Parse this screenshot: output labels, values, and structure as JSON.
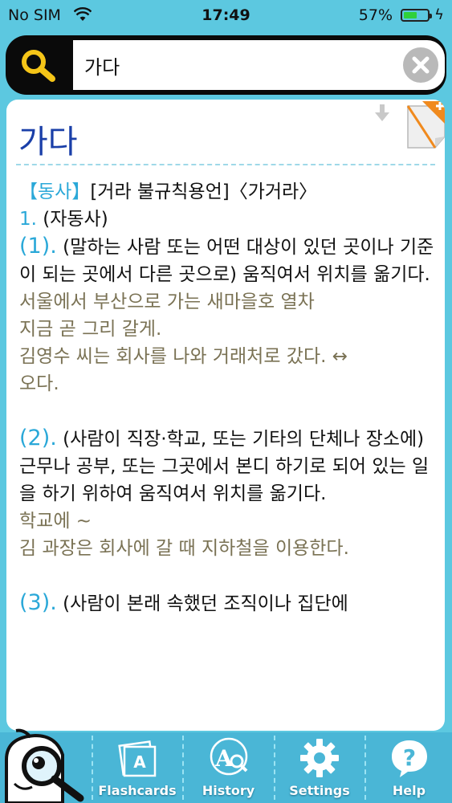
{
  "status": {
    "carrier": "No SIM",
    "time": "17:49",
    "battery": "57%",
    "battery_level": 0.57
  },
  "search": {
    "query": "가다"
  },
  "entry": {
    "headword": "가다",
    "pos": "【동사】",
    "conjugation": "[거라 불규칙용언]〈가거라〉",
    "num1": "1.",
    "sub1": "(자동사)",
    "s1_num": "(1).",
    "s1_def": "(말하는 사람 또는 어떤 대상이 있던 곳이나 기준이 되는 곳에서 다른 곳으로) 움직여서 위치를 옮기다.",
    "s1_ex1": "서울에서 부산으로 가는 새마을호 열차",
    "s1_ex2": "지금 곧 그리 갈게.",
    "s1_ex3": "김영수 씨는 회사를 나와 거래처로 갔다. ↔",
    "s1_ex4": "오다.",
    "s2_num": "(2).",
    "s2_def": "(사람이 직장·학교, 또는 기타의 단체나 장소에) 근무나 공부, 또는 그곳에서 본디 하기로 되어 있는 일을 하기 위하여 움직여서 위치를 옮기다.",
    "s2_ex1": "학교에 ~",
    "s2_ex2": "김 과장은 회사에 갈 때 지하철을 이용한다.",
    "s3_num": "(3).",
    "s3_def": "(사람이 본래 속했던 조직이나 집단에"
  },
  "tabs": {
    "flashcards": "Flashcards",
    "history": "History",
    "settings": "Settings",
    "help": "Help"
  },
  "colors": {
    "background": "#5cc8e0",
    "accent": "#2aa8d8",
    "headword": "#1a3fa8",
    "example": "#7a7254",
    "add_button": "#f08a1e"
  }
}
